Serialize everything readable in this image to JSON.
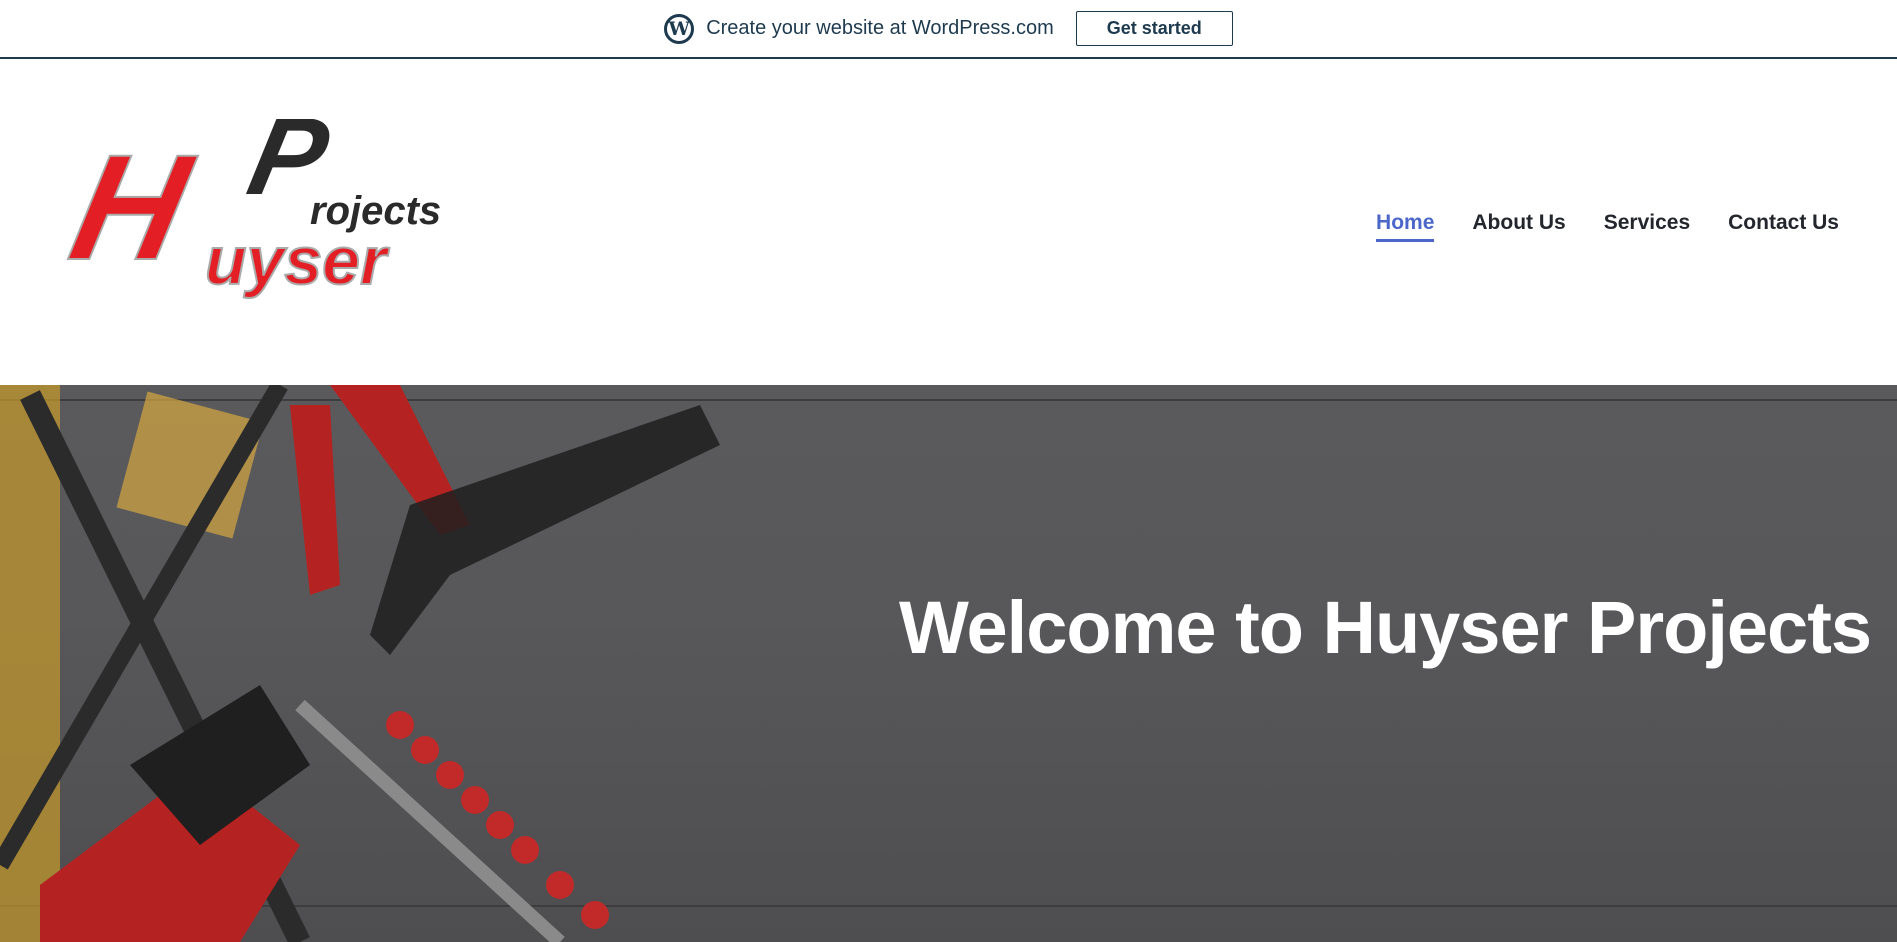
{
  "topbar": {
    "text": "Create your website at WordPress.com",
    "button": "Get started",
    "icon": "wordpress-icon"
  },
  "logo": {
    "text_top": "Projects",
    "text_main": "Huyser"
  },
  "nav": {
    "items": [
      {
        "label": "Home",
        "active": true
      },
      {
        "label": "About Us"
      },
      {
        "label": "Services"
      },
      {
        "label": "Contact Us"
      }
    ]
  },
  "hero": {
    "heading": "Welcome to Huyser Projects"
  },
  "colors": {
    "accent": "#4b67c9",
    "topbar": "#1d3a4f",
    "logo_red": "#e31e24"
  }
}
